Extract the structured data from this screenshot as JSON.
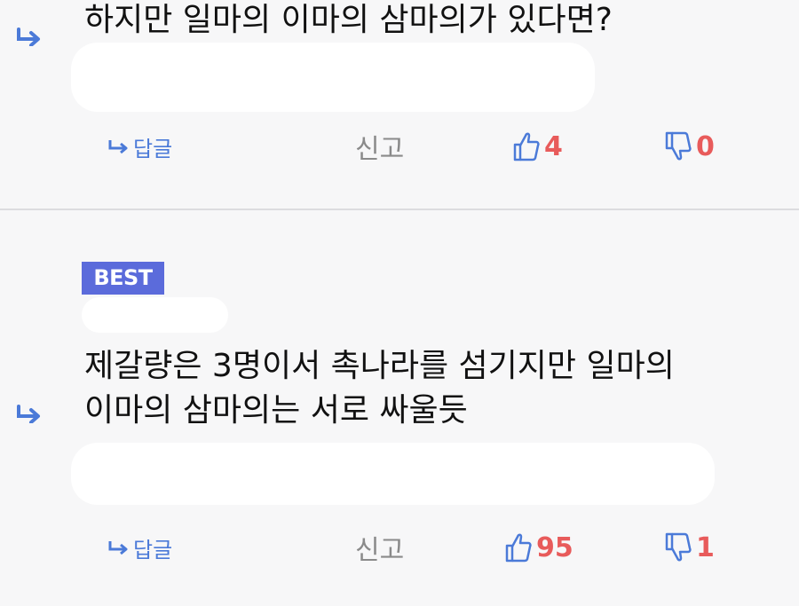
{
  "colors": {
    "accent": "#4b7ad8",
    "count": "#e85b5b",
    "best_badge": "#5b6bdb",
    "muted": "#8a8a8a"
  },
  "comments": [
    {
      "best": false,
      "lines": [
        "하지만 일마의 이마의 삼마의가 있다면?"
      ],
      "reply_label": "답글",
      "report_label": "신고",
      "likes": "4",
      "dislikes": "0"
    },
    {
      "best": true,
      "badge": "BEST",
      "lines": [
        "제갈량은 3명이서 촉나라를 섬기지만 일마의",
        "이마의 삼마의는 서로 싸울듯"
      ],
      "reply_label": "답글",
      "report_label": "신고",
      "likes": "95",
      "dislikes": "1"
    }
  ]
}
